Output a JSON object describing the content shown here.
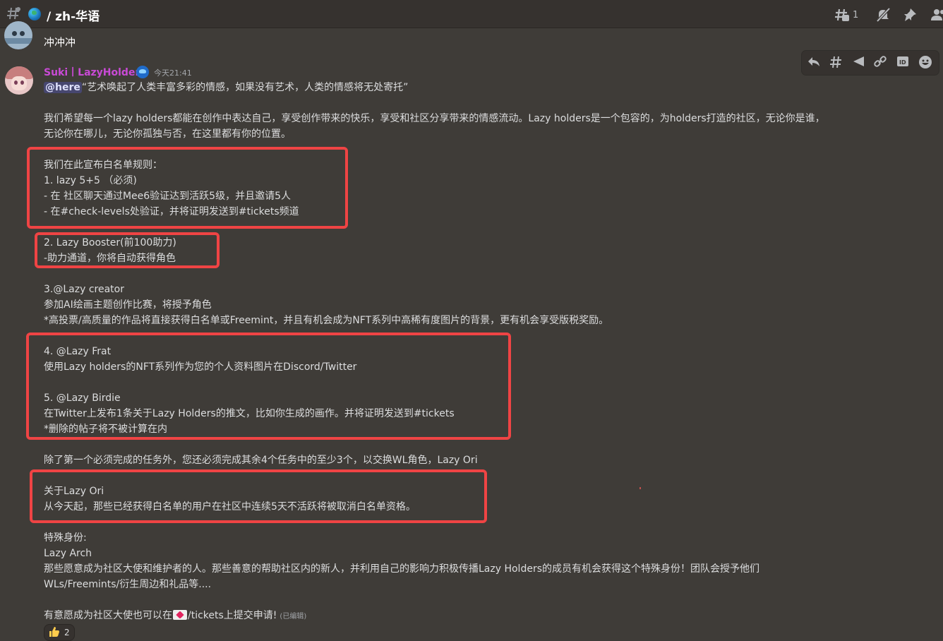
{
  "channel": {
    "name": "/ zh-华语",
    "thread_count": "1"
  },
  "icons": {
    "channel": "hash-icon",
    "globe": "globe-icon",
    "threads": "threads-icon",
    "mute": "mute-bell-icon",
    "pin": "pin-icon",
    "members": "members-icon"
  },
  "previous_message": {
    "text": "冲冲冲"
  },
  "hover_actions": [
    "reply-icon",
    "create-thread-icon",
    "forward-icon",
    "copy-link-icon",
    "copy-id-icon",
    "add-reaction-icon"
  ],
  "message": {
    "author": "Suki丨LazyHolders",
    "timestamp": "今天21:41",
    "mention": "@here",
    "lines": {
      "l1": "“艺术唤起了人类丰富多彩的情感，如果没有艺术，人类的情感将无处寄托”",
      "l2": "我们希望每一个lazy holders都能在创作中表达自己，享受创作带来的快乐，享受和社区分享带来的情感流动。Lazy holders是一个包容的，为holders打造的社区，无论你是谁，",
      "l3": "无论你在哪儿，无论你孤独与否，在这里都有你的位置。",
      "l4": "我们在此宣布白名单规则：",
      "l5": "1. lazy 5+5 （必须)",
      "l6": "- 在 社区聊天通过Mee6验证达到活跃5级，并且邀请5人",
      "l7": "- 在#check-levels处验证，并将证明发送到#tickets频道",
      "l8": "2. Lazy Booster(前100助力)",
      "l9": "-助力通道，你将自动获得角色",
      "l10": "3.@Lazy creator",
      "l11": "参加AI绘画主题创作比赛，将授予角色",
      "l12": "*高投票/高质量的作品将直接获得白名单或Freemint，并且有机会成为NFT系列中高稀有度图片的背景，更有机会享受版税奖励。",
      "l13": "4. @Lazy Frat",
      "l14": "使用Lazy holders的NFT系列作为您的个人资料图片在Discord/Twitter",
      "l15": "5. @Lazy Birdie",
      "l16": "在Twitter上发布1条关于Lazy Holders的推文，比如你生成的画作。并将证明发送到#tickets",
      "l17": "*删除的帖子将不被计算在内",
      "l18": "除了第一个必须完成的任务外，您还必须完成其余4个任务中的至少3个，以交换WL角色，Lazy Ori",
      "l19": "关于Lazy Ori",
      "l20": "从今天起，那些已经获得白名单的用户在社区中连续5天不活跃将被取消白名单资格。",
      "l21": "特殊身份:",
      "l22": "Lazy Arch",
      "l23": "那些愿意成为社区大使和维护者的人。那些善意的帮助社区内的新人，并利用自己的影响力积极传播Lazy Holders的成员有机会获得这个特殊身份！团队会授予他们",
      "l24": "WLs/Freemints/衍生周边和礼品等....",
      "l25a": "有意愿成为社区大使也可以在",
      "l25b": "/tickets上提交申请!"
    },
    "edited": "(已编辑)",
    "reaction": {
      "emoji": "thumbs-up-icon",
      "count": "2"
    }
  },
  "colors": {
    "highlight_box": "#ef4444",
    "author": "#c94ad6",
    "background": "#3f3c38"
  }
}
